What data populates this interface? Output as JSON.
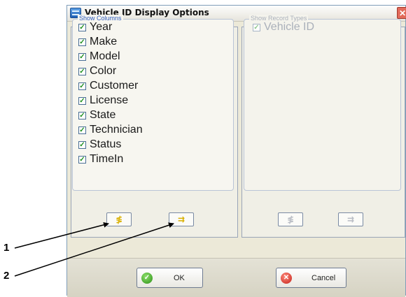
{
  "window": {
    "title": "Vehicle ID Display Options",
    "close_glyph": "✕"
  },
  "show_columns": {
    "legend": "Show Columns",
    "items": [
      {
        "label": "Year",
        "checked": true
      },
      {
        "label": "Make",
        "checked": true
      },
      {
        "label": "Model",
        "checked": true
      },
      {
        "label": "Color",
        "checked": true
      },
      {
        "label": "Customer",
        "checked": true
      },
      {
        "label": "License",
        "checked": true
      },
      {
        "label": "State",
        "checked": true
      },
      {
        "label": "Technician",
        "checked": true
      },
      {
        "label": "Status",
        "checked": true
      },
      {
        "label": "TimeIn",
        "checked": true
      }
    ],
    "buttons": [
      {
        "icon": "select-all-icon",
        "glyph": "≸"
      },
      {
        "icon": "deselect-all-icon",
        "glyph": "⇉"
      }
    ]
  },
  "show_record_types": {
    "legend": "Show Record Types",
    "items": [
      {
        "label": "Vehicle ID",
        "checked": true
      }
    ],
    "buttons": [
      {
        "icon": "select-all-icon",
        "glyph": "≸"
      },
      {
        "icon": "deselect-all-icon",
        "glyph": "⇉"
      }
    ]
  },
  "footer": {
    "ok_label": "OK",
    "cancel_label": "Cancel",
    "ok_glyph": "✓",
    "cancel_glyph": "✕"
  },
  "callouts": [
    "1",
    "2"
  ],
  "check_glyph": "✓"
}
